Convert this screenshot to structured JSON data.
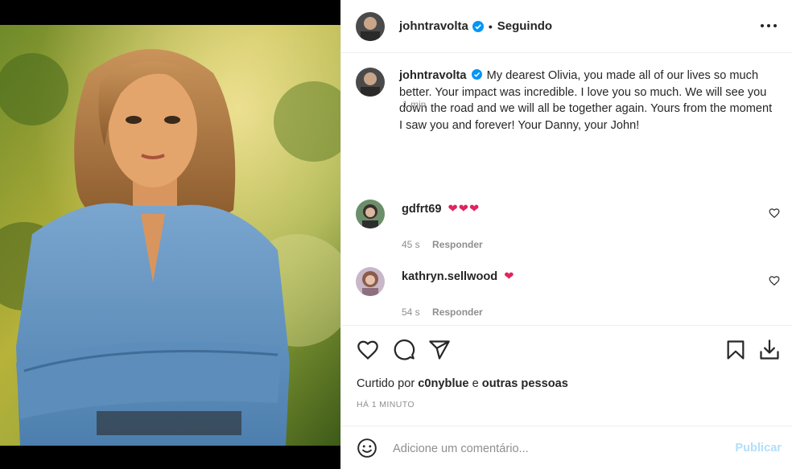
{
  "post": {
    "author": "johntravolta",
    "follow_status": "Seguindo",
    "separator": "•",
    "caption": "My dearest Olivia, you made all of our lives so much better. Your impact was incredible. I love you so much. We will see you down the road and we will all be together again. Yours from the moment I saw you and forever! Your Danny, your John!",
    "caption_time": "1 min",
    "verified_color": "#0095f6"
  },
  "comments": [
    {
      "user": "gdfrt69",
      "emoji": "❤❤❤",
      "time": "45 s",
      "reply_label": "Responder"
    },
    {
      "user": "kathryn.sellwood",
      "emoji": "❤",
      "time": "54 s",
      "reply_label": "Responder"
    }
  ],
  "actions": {
    "icons": [
      "heart-icon",
      "comment-icon",
      "share-icon",
      "bookmark-icon",
      "download-icon"
    ],
    "liked_by_prefix": "Curtido por",
    "liked_by_user": "c0nyblue",
    "liked_by_conj": "e",
    "liked_by_rest": "outras pessoas",
    "time_ago": "HÁ 1 MINUTO"
  },
  "composer": {
    "placeholder": "Adicione um comentário...",
    "publish_label": "Publicar",
    "publish_color": "#b2dffc"
  }
}
